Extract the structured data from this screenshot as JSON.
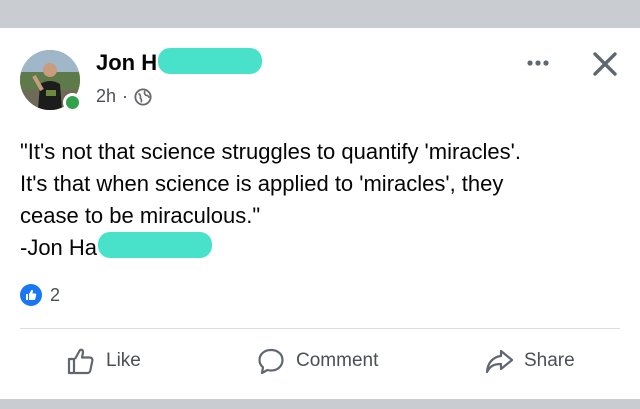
{
  "post": {
    "author_name": "Jon H",
    "timestamp": "2h",
    "separator": "·",
    "text": "\"It's not that science struggles to quantify 'miracles'.\nIt's that when science is applied to 'miracles', they\ncease to be miraculous.\"\n-Jon Ha",
    "reaction_count": "2"
  },
  "actions": {
    "like_label": "Like",
    "comment_label": "Comment",
    "share_label": "Share"
  },
  "colors": {
    "accent": "#1877f2",
    "presence": "#31a24c",
    "redaction": "#3ee0c8"
  },
  "icons": {
    "audience": "globe-icon",
    "more": "more-options-icon",
    "close": "close-icon",
    "reaction": "like-badge-icon"
  }
}
